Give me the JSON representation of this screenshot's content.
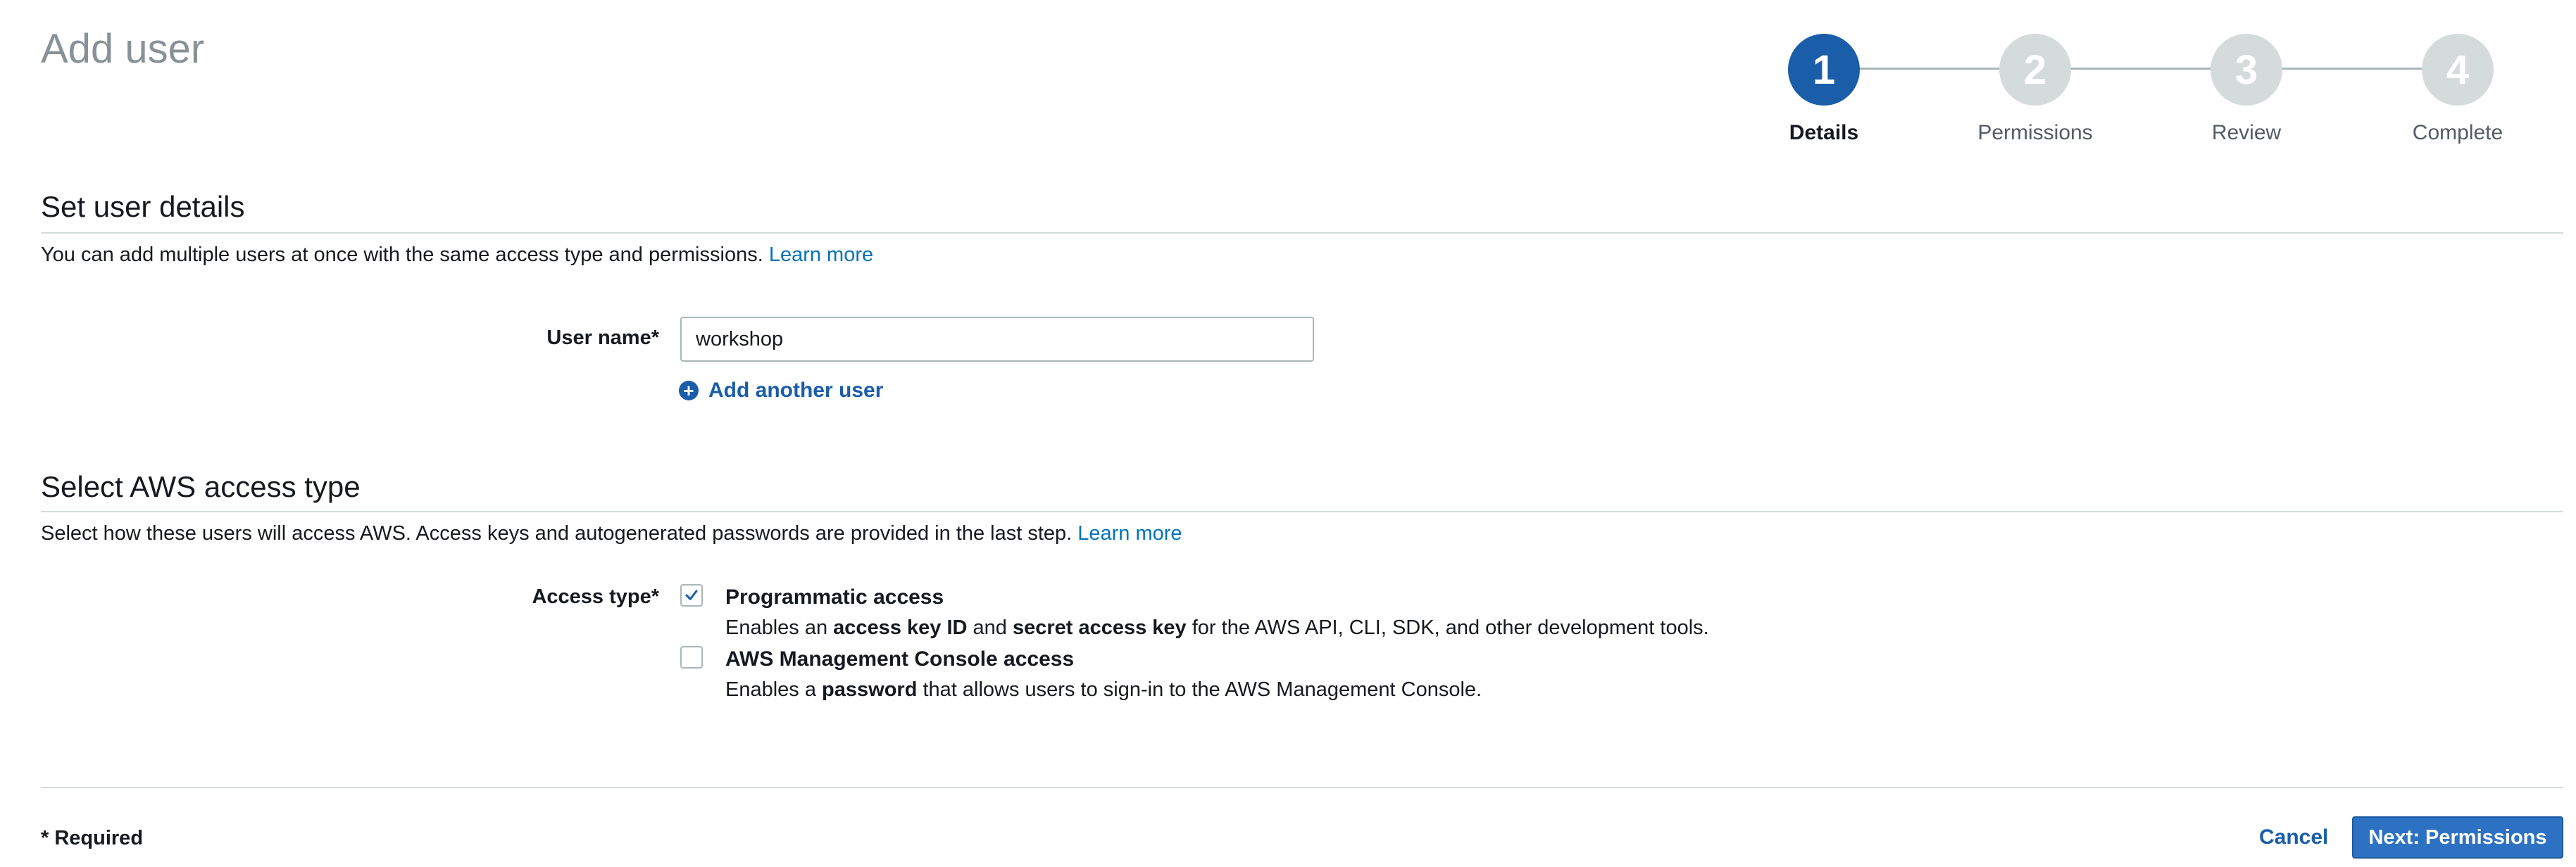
{
  "page": {
    "title": "Add user"
  },
  "stepper": {
    "steps": [
      {
        "number": "1",
        "label": "Details",
        "active": true
      },
      {
        "number": "2",
        "label": "Permissions",
        "active": false
      },
      {
        "number": "3",
        "label": "Review",
        "active": false
      },
      {
        "number": "4",
        "label": "Complete",
        "active": false
      }
    ]
  },
  "user_details": {
    "title": "Set user details",
    "description": "You can add multiple users at once with the same access type and permissions.",
    "learn_more": "Learn more",
    "username_label": "User name*",
    "username_value": "workshop",
    "add_another_label": "Add another user"
  },
  "access_type": {
    "title": "Select AWS access type",
    "description": "Select how these users will access AWS. Access keys and autogenerated passwords are provided in the last step.",
    "learn_more": "Learn more",
    "label": "Access type*",
    "options": [
      {
        "title": "Programmatic access",
        "checked": true,
        "desc_prefix": "Enables an ",
        "desc_bold1": "access key ID",
        "desc_mid": " and ",
        "desc_bold2": "secret access key",
        "desc_suffix": " for the AWS API, CLI, SDK, and other development tools."
      },
      {
        "title": "AWS Management Console access",
        "checked": false,
        "desc_prefix": "Enables a ",
        "desc_bold1": "password",
        "desc_suffix": " that allows users to sign-in to the AWS Management Console."
      }
    ]
  },
  "footer": {
    "required_note": "* Required",
    "cancel_label": "Cancel",
    "next_label": "Next: Permissions"
  },
  "colors": {
    "accent": "#1a5da9",
    "link": "#0073bb",
    "inactive_step": "#d5dbdb",
    "primary_button": "#2d72c2"
  }
}
